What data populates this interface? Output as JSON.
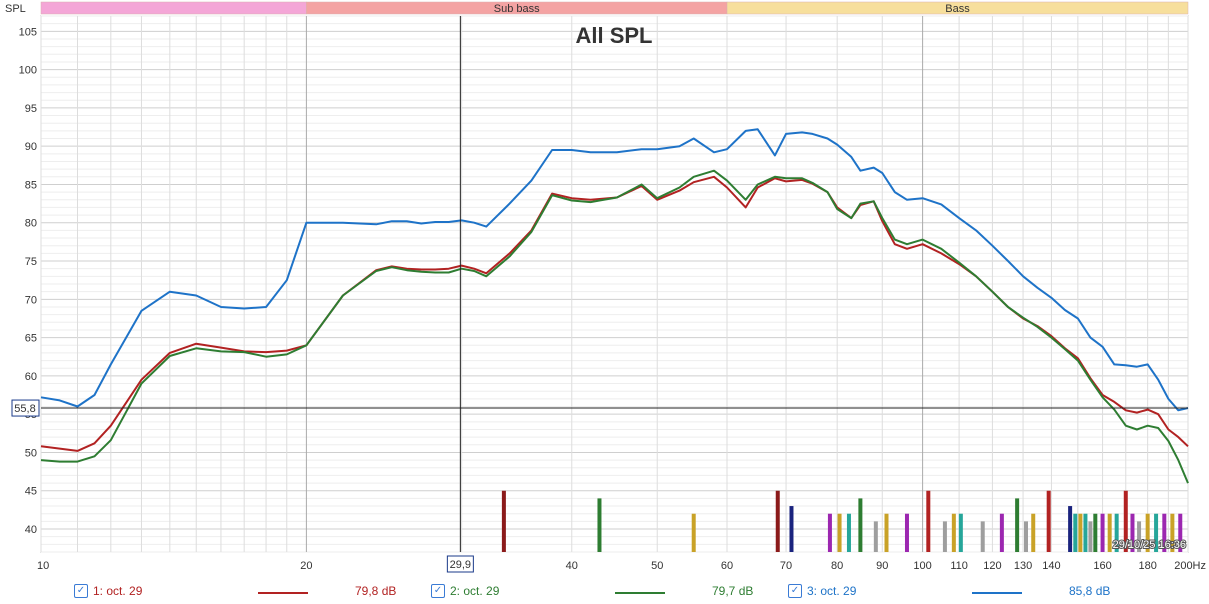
{
  "chart_data": {
    "type": "line",
    "title": "All SPL",
    "ylabel": "SPL",
    "xlabel": "Hz",
    "x_scale": "log",
    "xlim": [
      10,
      200
    ],
    "ylim": [
      37,
      107
    ],
    "x_ticks": [
      {
        "v": 10,
        "label": "10"
      },
      {
        "v": 20,
        "label": "20"
      },
      {
        "v": 30,
        "label": "30"
      },
      {
        "v": 40,
        "label": "40"
      },
      {
        "v": 50,
        "label": "50"
      },
      {
        "v": 60,
        "label": "60"
      },
      {
        "v": 70,
        "label": "70"
      },
      {
        "v": 80,
        "label": "80"
      },
      {
        "v": 90,
        "label": "90"
      },
      {
        "v": 100,
        "label": "100"
      },
      {
        "v": 110,
        "label": "110"
      },
      {
        "v": 120,
        "label": "120"
      },
      {
        "v": 130,
        "label": "130"
      },
      {
        "v": 140,
        "label": "140"
      },
      {
        "v": 160,
        "label": "160"
      },
      {
        "v": 180,
        "label": "180"
      },
      {
        "v": 200,
        "label": "200Hz"
      }
    ],
    "y_ticks": [
      40,
      45,
      50,
      55,
      60,
      65,
      70,
      75,
      80,
      85,
      90,
      95,
      100,
      105
    ],
    "bands": [
      {
        "label": "",
        "from": 10,
        "to": 20,
        "color": "#f4a6d7"
      },
      {
        "label": "Sub bass",
        "from": 20,
        "to": 60,
        "color": "#f4a3a3"
      },
      {
        "label": "Bass",
        "from": 60,
        "to": 200,
        "color": "#f7df9c"
      }
    ],
    "cursor": {
      "x": 29.9,
      "y": 55.8,
      "x_label": "29,9",
      "y_label": "55,8"
    },
    "timestamp": "29/10/25 16:36",
    "series": [
      {
        "name": "1: oct. 29",
        "color": "#b22222",
        "legend_value": "79,8 dB",
        "x": [
          10,
          10.5,
          11,
          11.5,
          12,
          13,
          14,
          15,
          16,
          17,
          18,
          19,
          20,
          22,
          24,
          25,
          26,
          27,
          28,
          29,
          30,
          31,
          32,
          34,
          36,
          38,
          40,
          42,
          43,
          45,
          48,
          50,
          53,
          55,
          58,
          60,
          63,
          65,
          68,
          70,
          73,
          75,
          78,
          80,
          83,
          85,
          88,
          90,
          93,
          96,
          100,
          105,
          110,
          115,
          120,
          125,
          130,
          135,
          140,
          145,
          150,
          155,
          160,
          165,
          170,
          175,
          180,
          185,
          190,
          195,
          200
        ],
        "y": [
          50.8,
          50.5,
          50.2,
          51.2,
          53.5,
          59.5,
          63.0,
          64.2,
          63.7,
          63.2,
          63.1,
          63.3,
          64.0,
          70.5,
          73.8,
          74.3,
          74.0,
          73.9,
          73.9,
          74.0,
          74.4,
          74.0,
          73.4,
          76.0,
          79.0,
          83.8,
          83.2,
          83.0,
          83.1,
          83.3,
          84.8,
          83.0,
          84.2,
          85.3,
          86.0,
          84.6,
          82.0,
          84.6,
          85.8,
          85.4,
          85.6,
          85.1,
          84.0,
          82.0,
          80.6,
          82.3,
          82.8,
          80.2,
          77.2,
          76.6,
          77.2,
          76.0,
          74.6,
          73.0,
          71.0,
          69.0,
          67.5,
          66.5,
          65.2,
          63.6,
          62.3,
          59.7,
          57.5,
          56.6,
          55.5,
          55.2,
          55.6,
          55.0,
          53.0,
          52.0,
          50.8
        ]
      },
      {
        "name": "2: oct. 29",
        "color": "#2e7d32",
        "legend_value": "79,7 dB",
        "x": [
          10,
          10.5,
          11,
          11.5,
          12,
          13,
          14,
          15,
          16,
          17,
          18,
          19,
          20,
          22,
          24,
          25,
          26,
          27,
          28,
          29,
          30,
          31,
          32,
          34,
          36,
          38,
          40,
          42,
          43,
          45,
          48,
          50,
          53,
          55,
          58,
          60,
          63,
          65,
          68,
          70,
          73,
          75,
          78,
          80,
          83,
          85,
          88,
          90,
          93,
          96,
          100,
          105,
          110,
          115,
          120,
          125,
          130,
          135,
          140,
          145,
          150,
          155,
          160,
          165,
          170,
          175,
          180,
          185,
          190,
          195,
          200
        ],
        "y": [
          49.0,
          48.8,
          48.8,
          49.5,
          51.6,
          59.0,
          62.6,
          63.6,
          63.2,
          63.1,
          62.5,
          62.8,
          64.0,
          70.5,
          73.7,
          74.2,
          73.8,
          73.6,
          73.5,
          73.5,
          74.0,
          73.7,
          73.0,
          75.6,
          78.8,
          83.6,
          82.9,
          82.7,
          82.9,
          83.3,
          85.0,
          83.2,
          84.6,
          86.0,
          86.8,
          85.5,
          83.0,
          85.0,
          86.0,
          85.8,
          85.8,
          85.2,
          84.0,
          81.8,
          80.6,
          82.5,
          82.8,
          80.6,
          77.8,
          77.2,
          77.8,
          76.6,
          74.8,
          73.0,
          71.0,
          69.0,
          67.6,
          66.4,
          65.0,
          63.5,
          62.0,
          59.5,
          57.2,
          55.6,
          53.5,
          53.0,
          53.5,
          53.2,
          51.5,
          49.0,
          46.0
        ]
      },
      {
        "name": "3: oct. 29",
        "color": "#1e73c8",
        "legend_value": "85,8 dB",
        "x": [
          10,
          10.5,
          11,
          11.5,
          12,
          13,
          14,
          15,
          16,
          17,
          18,
          19,
          20,
          22,
          24,
          25,
          26,
          27,
          28,
          29,
          30,
          31,
          32,
          34,
          36,
          38,
          40,
          42,
          43,
          45,
          48,
          50,
          53,
          55,
          58,
          60,
          63,
          65,
          68,
          70,
          73,
          75,
          78,
          80,
          83,
          85,
          88,
          90,
          93,
          96,
          100,
          105,
          110,
          115,
          120,
          125,
          130,
          135,
          140,
          145,
          150,
          155,
          160,
          165,
          170,
          175,
          180,
          185,
          190,
          195,
          200
        ],
        "y": [
          57.2,
          56.8,
          56.0,
          57.5,
          61.5,
          68.5,
          71.0,
          70.5,
          69.0,
          68.8,
          69.0,
          72.5,
          80.0,
          80.0,
          79.8,
          80.2,
          80.2,
          79.9,
          80.1,
          80.1,
          80.3,
          80.0,
          79.5,
          82.5,
          85.5,
          89.5,
          89.5,
          89.2,
          89.2,
          89.2,
          89.6,
          89.6,
          90.0,
          91.0,
          89.2,
          89.6,
          92.0,
          92.2,
          88.8,
          91.6,
          91.8,
          91.6,
          91.0,
          90.2,
          88.6,
          86.8,
          87.2,
          86.5,
          84.0,
          83.0,
          83.2,
          82.4,
          80.6,
          79.0,
          77.0,
          75.0,
          73.0,
          71.5,
          70.2,
          68.6,
          67.5,
          65.0,
          63.8,
          61.5,
          61.4,
          61.2,
          61.5,
          59.5,
          57.0,
          55.5,
          55.8
        ]
      }
    ],
    "markers": [
      {
        "x": 33.5,
        "h": 45,
        "color": "#8b1a1a"
      },
      {
        "x": 43,
        "h": 44,
        "color": "#2e7d32"
      },
      {
        "x": 55,
        "h": 42,
        "color": "#c9a227"
      },
      {
        "x": 68.5,
        "h": 45,
        "color": "#8b1a1a"
      },
      {
        "x": 71,
        "h": 43,
        "color": "#1a237e"
      },
      {
        "x": 78.5,
        "h": 42,
        "color": "#9c27b0"
      },
      {
        "x": 80.5,
        "h": 42,
        "color": "#c9a227"
      },
      {
        "x": 82.5,
        "h": 42,
        "color": "#26a69a"
      },
      {
        "x": 85,
        "h": 44,
        "color": "#2e7d32"
      },
      {
        "x": 88.5,
        "h": 41,
        "color": "#9e9e9e"
      },
      {
        "x": 91,
        "h": 42,
        "color": "#c9a227"
      },
      {
        "x": 96,
        "h": 42,
        "color": "#9c27b0"
      },
      {
        "x": 101.5,
        "h": 45,
        "color": "#b22222"
      },
      {
        "x": 106,
        "h": 41,
        "color": "#9e9e9e"
      },
      {
        "x": 108.5,
        "h": 42,
        "color": "#c9a227"
      },
      {
        "x": 110.5,
        "h": 42,
        "color": "#26a69a"
      },
      {
        "x": 117,
        "h": 41,
        "color": "#9e9e9e"
      },
      {
        "x": 123,
        "h": 42,
        "color": "#9c27b0"
      },
      {
        "x": 128,
        "h": 44,
        "color": "#2e7d32"
      },
      {
        "x": 131,
        "h": 41,
        "color": "#9e9e9e"
      },
      {
        "x": 133.5,
        "h": 42,
        "color": "#c9a227"
      },
      {
        "x": 139,
        "h": 45,
        "color": "#b22222"
      },
      {
        "x": 147,
        "h": 43,
        "color": "#1a237e"
      },
      {
        "x": 149,
        "h": 42,
        "color": "#26a69a"
      },
      {
        "x": 151,
        "h": 42,
        "color": "#c9a227"
      },
      {
        "x": 153,
        "h": 42,
        "color": "#26a69a"
      },
      {
        "x": 155,
        "h": 41,
        "color": "#9e9e9e"
      },
      {
        "x": 157,
        "h": 42,
        "color": "#2e7d32"
      },
      {
        "x": 160,
        "h": 42,
        "color": "#9c27b0"
      },
      {
        "x": 163,
        "h": 42,
        "color": "#c9a227"
      },
      {
        "x": 166,
        "h": 42,
        "color": "#26a69a"
      },
      {
        "x": 170,
        "h": 45,
        "color": "#b22222"
      },
      {
        "x": 173,
        "h": 42,
        "color": "#9c27b0"
      },
      {
        "x": 176,
        "h": 41,
        "color": "#9e9e9e"
      },
      {
        "x": 180,
        "h": 42,
        "color": "#c9a227"
      },
      {
        "x": 184,
        "h": 42,
        "color": "#26a69a"
      },
      {
        "x": 188,
        "h": 42,
        "color": "#9c27b0"
      },
      {
        "x": 192,
        "h": 42,
        "color": "#c9a227"
      },
      {
        "x": 196,
        "h": 42,
        "color": "#9c27b0"
      }
    ]
  },
  "legend": [
    {
      "label": "1: oct. 29",
      "value": "79,8 dB",
      "color": "#b22222",
      "checked": true
    },
    {
      "label": "2: oct. 29",
      "value": "79,7 dB",
      "color": "#2e7d32",
      "checked": true
    },
    {
      "label": "3: oct. 29",
      "value": "85,8 dB",
      "color": "#1e73c8",
      "checked": true
    }
  ]
}
